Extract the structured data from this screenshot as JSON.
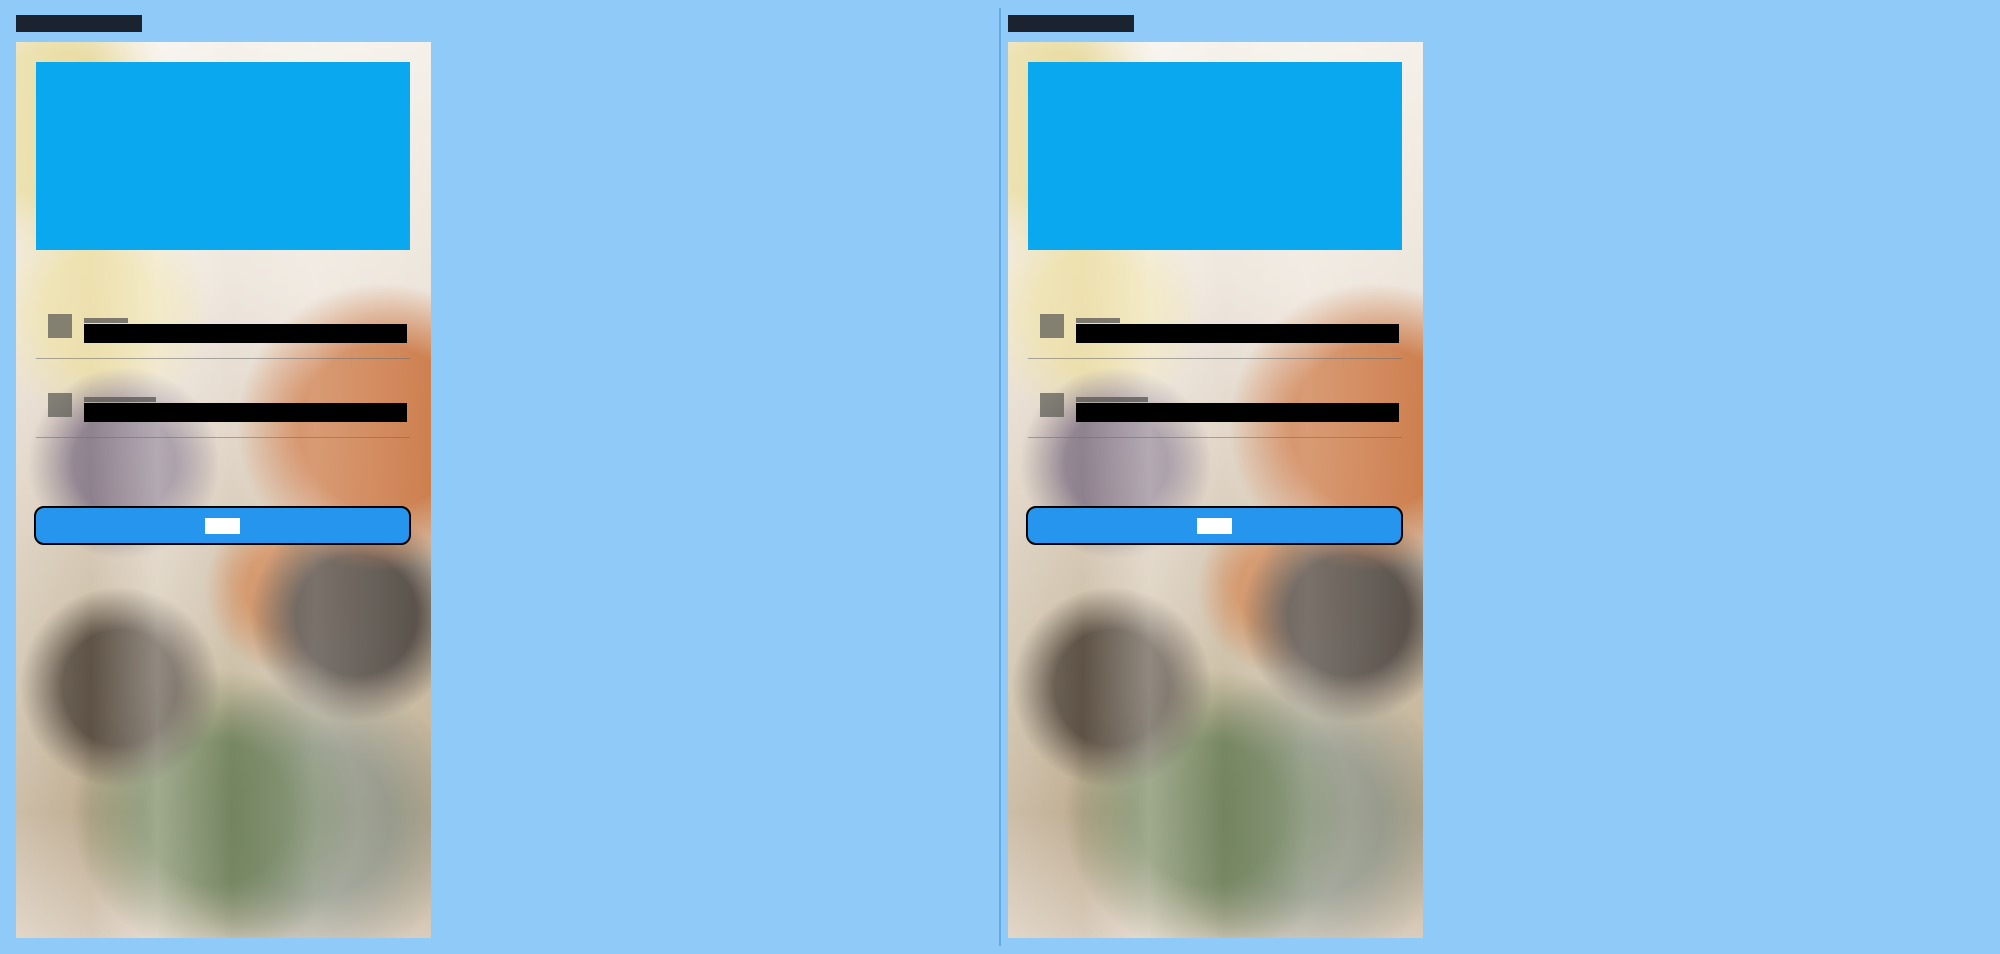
{
  "left_screen": {
    "title": "",
    "username_label": "",
    "username_value": "",
    "password_label": "",
    "password_value": "",
    "button_label": ""
  },
  "right_screen": {
    "title": "",
    "username_label": "",
    "username_value": "",
    "password_label": "",
    "password_value": "",
    "button_label": ""
  },
  "colors": {
    "page_background": "#90caf9",
    "hero_block": "#03a9f4",
    "button_background": "#2196f3",
    "divider": "#64a9df"
  },
  "icons": {
    "username_field": "user-icon",
    "password_field": "lock-icon"
  }
}
